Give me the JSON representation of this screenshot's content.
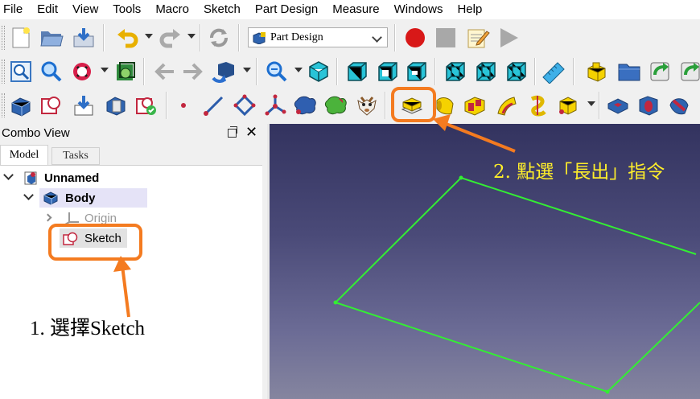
{
  "menubar": {
    "items": [
      "File",
      "Edit",
      "View",
      "Tools",
      "Macro",
      "Sketch",
      "Part Design",
      "Measure",
      "Windows",
      "Help"
    ]
  },
  "toolbar": {
    "workbench_selector": "Part Design"
  },
  "combo_view": {
    "title": "Combo View",
    "tabs": [
      "Model",
      "Tasks"
    ],
    "tree": {
      "document": "Unnamed",
      "body": "Body",
      "origin": "Origin",
      "sketch": "Sketch"
    }
  },
  "annotations": {
    "step1": "1. 選擇Sketch",
    "step2": "2. 點選「長出」指令"
  },
  "colors": {
    "annotation_orange": "#f47b20",
    "annotation_yellow": "#ffef2a",
    "sketch_line": "#33ee33",
    "viewport_top": "#33335f",
    "viewport_bottom": "#85859f",
    "selection_bg": "#e5e3f7"
  }
}
